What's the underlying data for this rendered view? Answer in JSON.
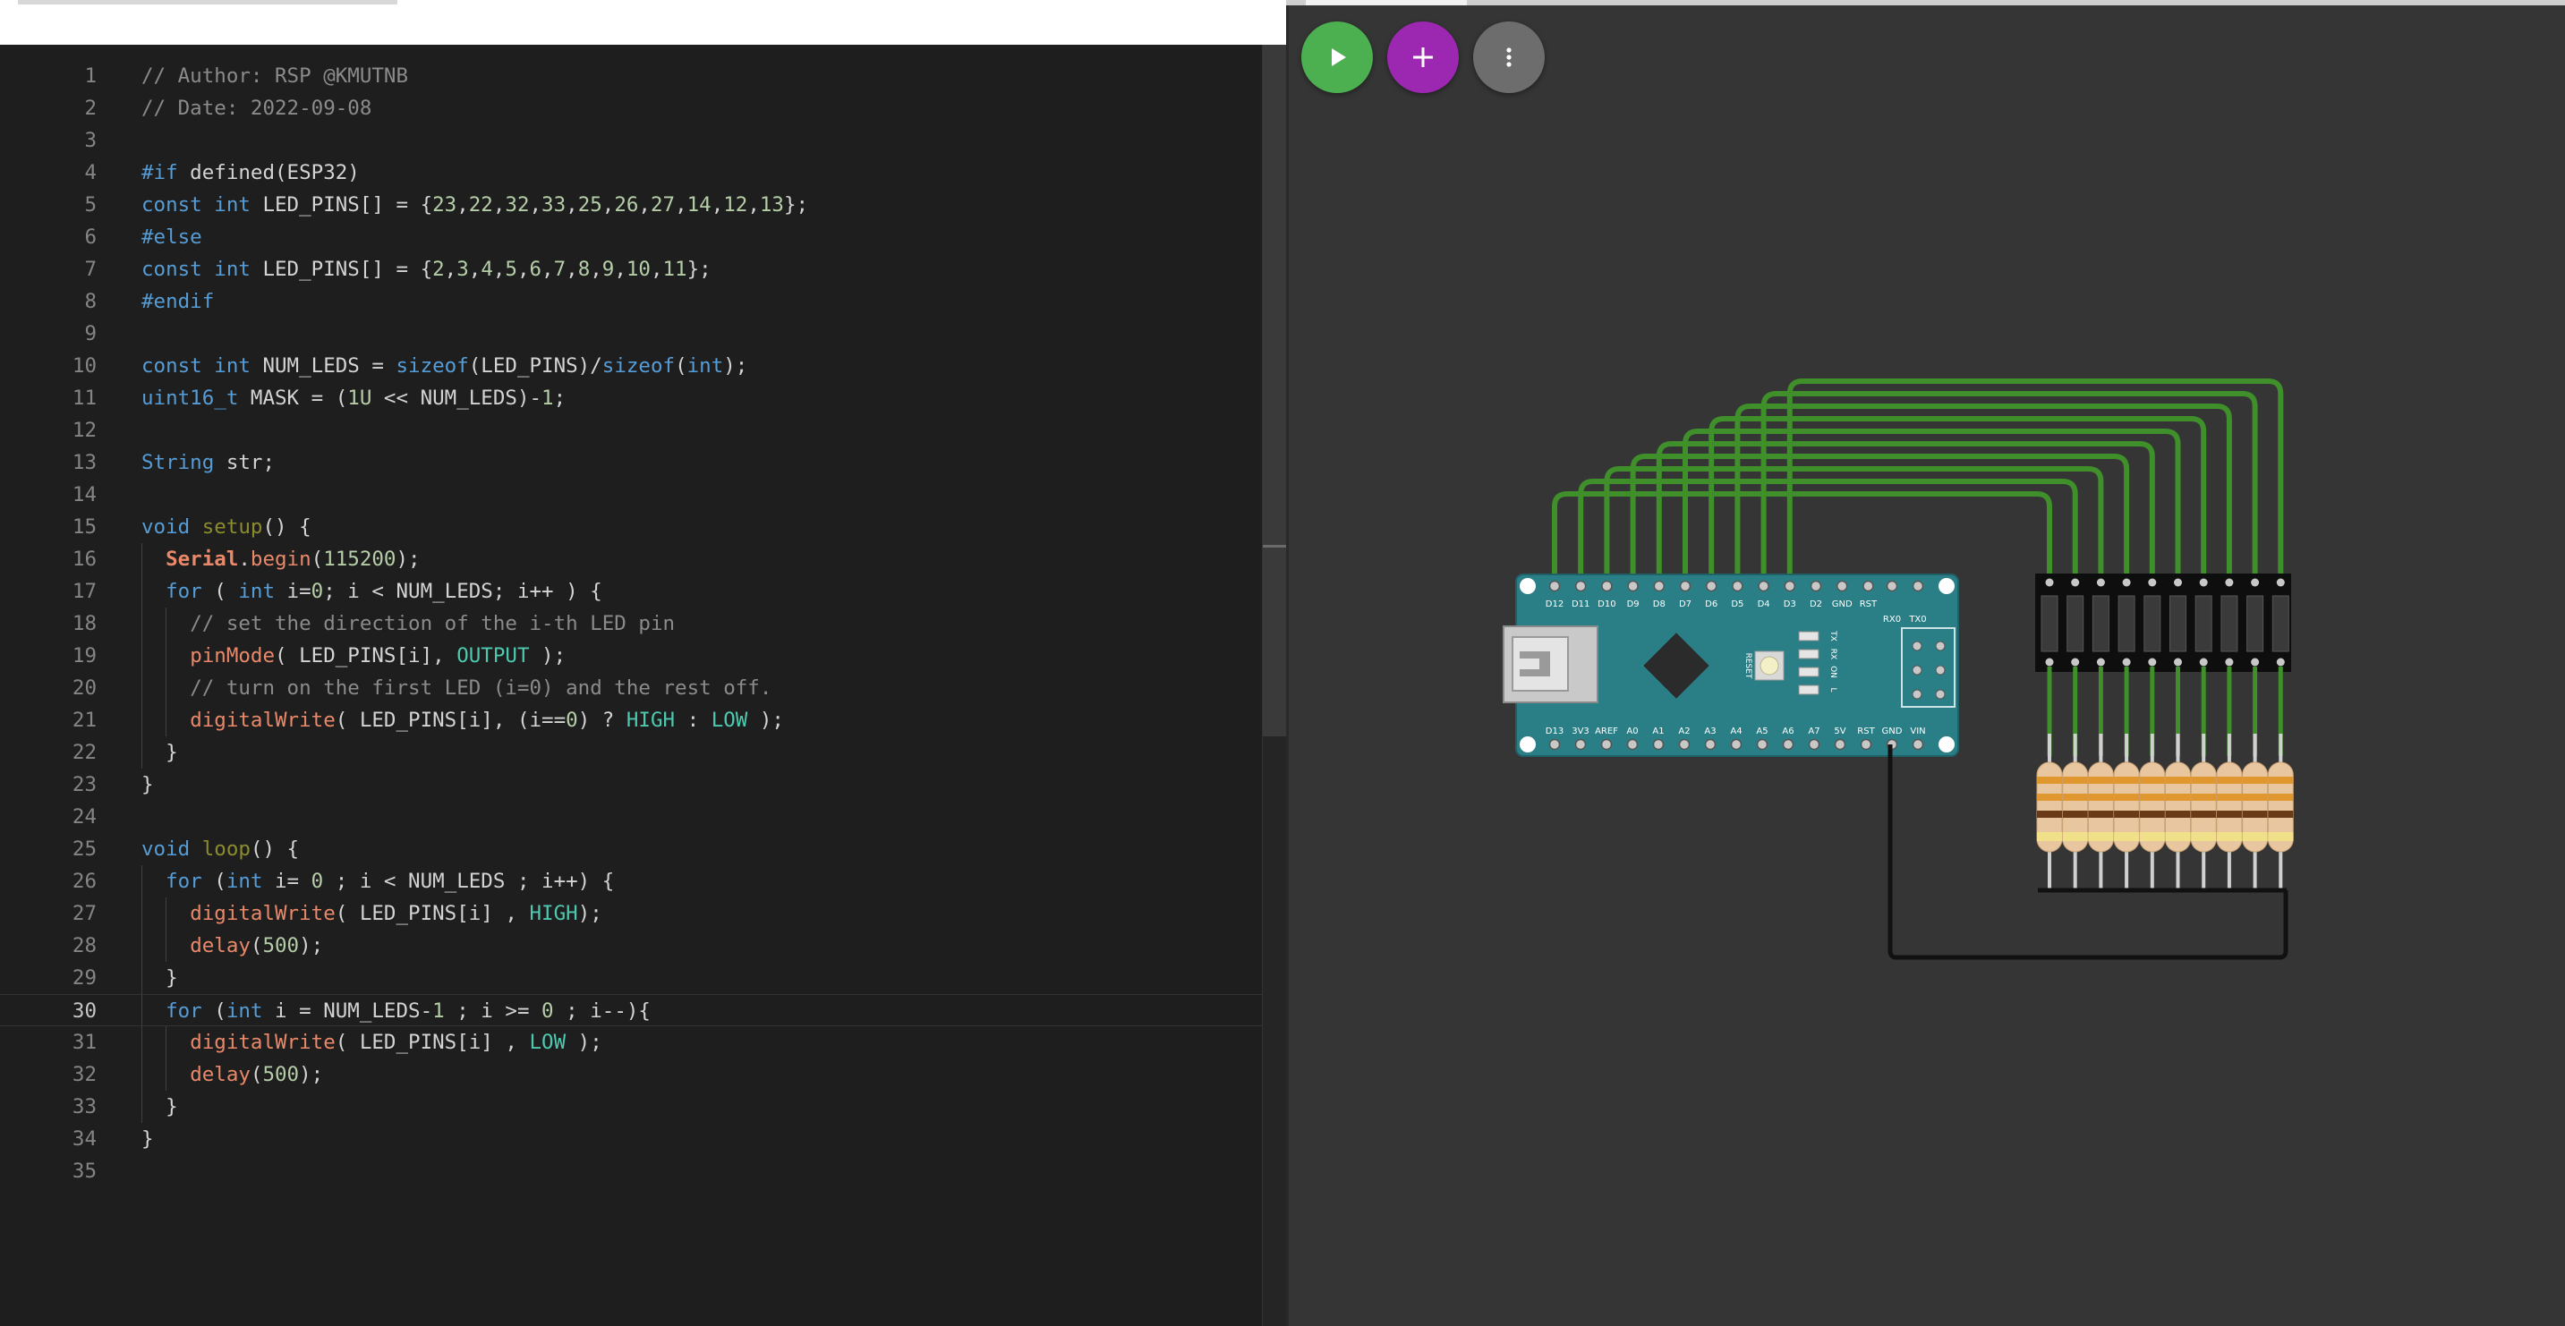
{
  "editor": {
    "lines": [
      {
        "n": "1",
        "tokens": [
          [
            "t-cmt",
            "// Author: RSP @KMUTNB"
          ]
        ]
      },
      {
        "n": "2",
        "tokens": [
          [
            "t-cmt",
            "// Date: 2022-09-08"
          ]
        ]
      },
      {
        "n": "3",
        "tokens": []
      },
      {
        "n": "4",
        "tokens": [
          [
            "t-pp",
            "#if"
          ],
          [
            "",
            " defined(ESP32)"
          ]
        ]
      },
      {
        "n": "5",
        "tokens": [
          [
            "t-kw",
            "const"
          ],
          [
            "",
            " "
          ],
          [
            "t-kw",
            "int"
          ],
          [
            "",
            " LED_PINS[] = {"
          ],
          [
            "t-num",
            "23"
          ],
          [
            "",
            ","
          ],
          [
            "t-num",
            "22"
          ],
          [
            "",
            ","
          ],
          [
            "t-num",
            "32"
          ],
          [
            "",
            ","
          ],
          [
            "t-num",
            "33"
          ],
          [
            "",
            ","
          ],
          [
            "t-num",
            "25"
          ],
          [
            "",
            ","
          ],
          [
            "t-num",
            "26"
          ],
          [
            "",
            ","
          ],
          [
            "t-num",
            "27"
          ],
          [
            "",
            ","
          ],
          [
            "t-num",
            "14"
          ],
          [
            "",
            ","
          ],
          [
            "t-num",
            "12"
          ],
          [
            "",
            ","
          ],
          [
            "t-num",
            "13"
          ],
          [
            "",
            "};"
          ]
        ]
      },
      {
        "n": "6",
        "tokens": [
          [
            "t-pp",
            "#else"
          ]
        ]
      },
      {
        "n": "7",
        "tokens": [
          [
            "t-kw",
            "const"
          ],
          [
            "",
            " "
          ],
          [
            "t-kw",
            "int"
          ],
          [
            "",
            " LED_PINS[] = {"
          ],
          [
            "t-num",
            "2"
          ],
          [
            "",
            ","
          ],
          [
            "t-num",
            "3"
          ],
          [
            "",
            ","
          ],
          [
            "t-num",
            "4"
          ],
          [
            "",
            ","
          ],
          [
            "t-num",
            "5"
          ],
          [
            "",
            ","
          ],
          [
            "t-num",
            "6"
          ],
          [
            "",
            ","
          ],
          [
            "t-num",
            "7"
          ],
          [
            "",
            ","
          ],
          [
            "t-num",
            "8"
          ],
          [
            "",
            ","
          ],
          [
            "t-num",
            "9"
          ],
          [
            "",
            ","
          ],
          [
            "t-num",
            "10"
          ],
          [
            "",
            ","
          ],
          [
            "t-num",
            "11"
          ],
          [
            "",
            "};"
          ]
        ]
      },
      {
        "n": "8",
        "tokens": [
          [
            "t-pp",
            "#endif"
          ]
        ]
      },
      {
        "n": "9",
        "tokens": []
      },
      {
        "n": "10",
        "tokens": [
          [
            "t-kw",
            "const"
          ],
          [
            "",
            " "
          ],
          [
            "t-kw",
            "int"
          ],
          [
            "",
            " NUM_LEDS = "
          ],
          [
            "t-kw",
            "sizeof"
          ],
          [
            "",
            "(LED_PINS)/"
          ],
          [
            "t-kw",
            "sizeof"
          ],
          [
            "",
            "("
          ],
          [
            "t-kw",
            "int"
          ],
          [
            "",
            ");"
          ]
        ]
      },
      {
        "n": "11",
        "tokens": [
          [
            "t-kw",
            "uint16_t"
          ],
          [
            "",
            " MASK = ("
          ],
          [
            "t-num",
            "1U"
          ],
          [
            "",
            " << NUM_LEDS)-"
          ],
          [
            "t-num",
            "1"
          ],
          [
            "",
            ";"
          ]
        ]
      },
      {
        "n": "12",
        "tokens": []
      },
      {
        "n": "13",
        "tokens": [
          [
            "t-kw",
            "String"
          ],
          [
            "",
            " str;"
          ]
        ]
      },
      {
        "n": "14",
        "tokens": []
      },
      {
        "n": "15",
        "tokens": [
          [
            "t-kw",
            "void"
          ],
          [
            "",
            " "
          ],
          [
            "t-setup",
            "setup"
          ],
          [
            "",
            "() {"
          ]
        ]
      },
      {
        "n": "16",
        "tokens": [
          [
            "",
            "  "
          ],
          [
            "t-obj",
            "Serial"
          ],
          [
            "",
            "."
          ],
          [
            "t-fn2",
            "begin"
          ],
          [
            "",
            "("
          ],
          [
            "t-num",
            "115200"
          ],
          [
            "",
            ");"
          ]
        ]
      },
      {
        "n": "17",
        "tokens": [
          [
            "",
            "  "
          ],
          [
            "t-kw",
            "for"
          ],
          [
            "",
            " ( "
          ],
          [
            "t-kw",
            "int"
          ],
          [
            "",
            " i="
          ],
          [
            "t-num",
            "0"
          ],
          [
            "",
            "; i < NUM_LEDS; i++ ) {"
          ]
        ]
      },
      {
        "n": "18",
        "tokens": [
          [
            "",
            "    "
          ],
          [
            "t-cmt",
            "// set the direction of the i-th LED pin"
          ]
        ]
      },
      {
        "n": "19",
        "tokens": [
          [
            "",
            "    "
          ],
          [
            "t-fn2",
            "pinMode"
          ],
          [
            "",
            "( LED_PINS[i], "
          ],
          [
            "t-const",
            "OUTPUT"
          ],
          [
            "",
            " );"
          ]
        ]
      },
      {
        "n": "20",
        "tokens": [
          [
            "",
            "    "
          ],
          [
            "t-cmt",
            "// turn on the first LED (i=0) and the rest off."
          ]
        ]
      },
      {
        "n": "21",
        "tokens": [
          [
            "",
            "    "
          ],
          [
            "t-fn2",
            "digitalWrite"
          ],
          [
            "",
            "( LED_PINS[i], (i=="
          ],
          [
            "t-num",
            "0"
          ],
          [
            "",
            ") ? "
          ],
          [
            "t-const",
            "HIGH"
          ],
          [
            "",
            " : "
          ],
          [
            "t-const",
            "LOW"
          ],
          [
            "",
            " );"
          ]
        ]
      },
      {
        "n": "22",
        "tokens": [
          [
            "",
            "  }"
          ]
        ]
      },
      {
        "n": "23",
        "tokens": [
          [
            "",
            "}"
          ]
        ]
      },
      {
        "n": "24",
        "tokens": []
      },
      {
        "n": "25",
        "tokens": [
          [
            "t-kw",
            "void"
          ],
          [
            "",
            " "
          ],
          [
            "t-setup",
            "loop"
          ],
          [
            "",
            "() {"
          ]
        ]
      },
      {
        "n": "26",
        "tokens": [
          [
            "",
            "  "
          ],
          [
            "t-kw",
            "for"
          ],
          [
            "",
            " ("
          ],
          [
            "t-kw",
            "int"
          ],
          [
            "",
            " i= "
          ],
          [
            "t-num",
            "0"
          ],
          [
            "",
            " ; i < NUM_LEDS ; i++) {"
          ]
        ]
      },
      {
        "n": "27",
        "tokens": [
          [
            "",
            "    "
          ],
          [
            "t-fn2",
            "digitalWrite"
          ],
          [
            "",
            "( LED_PINS[i] , "
          ],
          [
            "t-const",
            "HIGH"
          ],
          [
            "",
            ");"
          ]
        ]
      },
      {
        "n": "28",
        "tokens": [
          [
            "",
            "    "
          ],
          [
            "t-fn2",
            "delay"
          ],
          [
            "",
            "("
          ],
          [
            "t-num",
            "500"
          ],
          [
            "",
            ");"
          ]
        ]
      },
      {
        "n": "29",
        "tokens": [
          [
            "",
            "  }"
          ]
        ]
      },
      {
        "n": "30",
        "current": true,
        "tokens": [
          [
            "",
            "  "
          ],
          [
            "t-kw",
            "for"
          ],
          [
            "",
            " ("
          ],
          [
            "t-kw",
            "int"
          ],
          [
            "",
            " i = NUM_LEDS-"
          ],
          [
            "t-num",
            "1"
          ],
          [
            "",
            " ; i >= "
          ],
          [
            "t-num",
            "0"
          ],
          [
            "",
            " ; i--){"
          ]
        ]
      },
      {
        "n": "31",
        "tokens": [
          [
            "",
            "    "
          ],
          [
            "t-fn2",
            "digitalWrite"
          ],
          [
            "",
            "( LED_PINS[i] , "
          ],
          [
            "t-const",
            "LOW"
          ],
          [
            "",
            " );"
          ]
        ]
      },
      {
        "n": "32",
        "tokens": [
          [
            "",
            "    "
          ],
          [
            "t-fn2",
            "delay"
          ],
          [
            "",
            "("
          ],
          [
            "t-num",
            "500"
          ],
          [
            "",
            ");"
          ]
        ]
      },
      {
        "n": "33",
        "tokens": [
          [
            "",
            "  }"
          ]
        ]
      },
      {
        "n": "34",
        "tokens": [
          [
            "",
            "}"
          ]
        ]
      },
      {
        "n": "35",
        "tokens": []
      }
    ]
  },
  "toolbar": {
    "run_icon": "play-icon",
    "add_icon": "plus-icon",
    "more_icon": "more-vertical-icon",
    "run_color": "#4caf50",
    "add_color": "#9c27b0",
    "more_color": "#6d6d6d"
  },
  "board": {
    "top_pins": [
      "D12",
      "D11",
      "D10",
      "D9",
      "D8",
      "D7",
      "D6",
      "D5",
      "D4",
      "D3",
      "D2",
      "GND",
      "RST"
    ],
    "top_right_labels": [
      "RX0",
      "TX0"
    ],
    "bottom_pins": [
      "D13",
      "3V3",
      "AREF",
      "A0",
      "A1",
      "A2",
      "A3",
      "A4",
      "A5",
      "A6",
      "A7",
      "5V",
      "RST",
      "GND",
      "VIN"
    ],
    "reset_label": "RESET",
    "led_labels": [
      "TX",
      "RX",
      "ON",
      "L"
    ],
    "color": "#2a7f86"
  },
  "components": {
    "led_bar_segments": 10,
    "resistor_count": 10,
    "wire_color": "#3f8f2a"
  }
}
